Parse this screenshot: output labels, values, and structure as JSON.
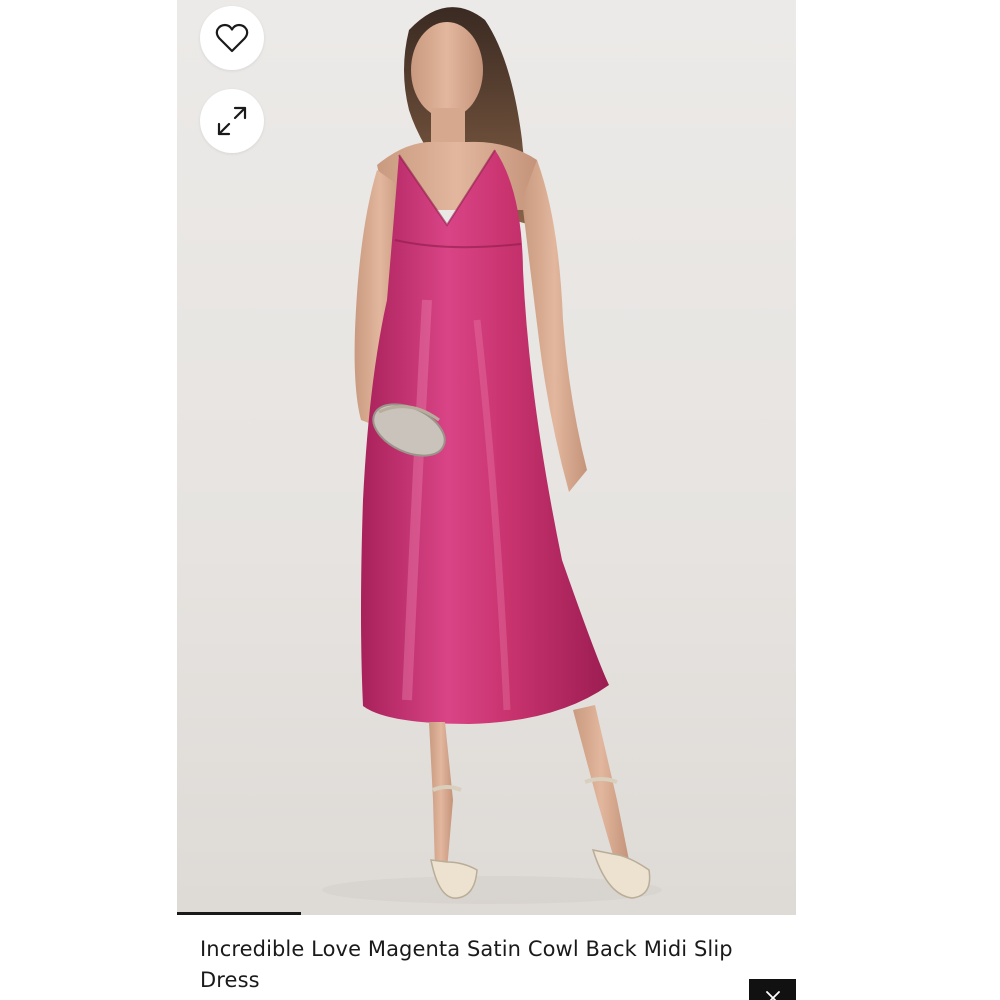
{
  "product": {
    "title": "Incredible Love Magenta Satin Cowl Back Midi Slip Dress",
    "dress_color": "#c8336e",
    "image_alt": "Model wearing magenta satin midi slip dress with silver clutch and heels"
  },
  "actions": {
    "favorite_icon": "heart-icon",
    "expand_icon": "expand-icon",
    "close_icon": "close-icon"
  },
  "gallery": {
    "progress": 0.2
  },
  "colors": {
    "accent": "#111111",
    "background": "#ffffff",
    "photo_background": "#e8e5e2"
  }
}
